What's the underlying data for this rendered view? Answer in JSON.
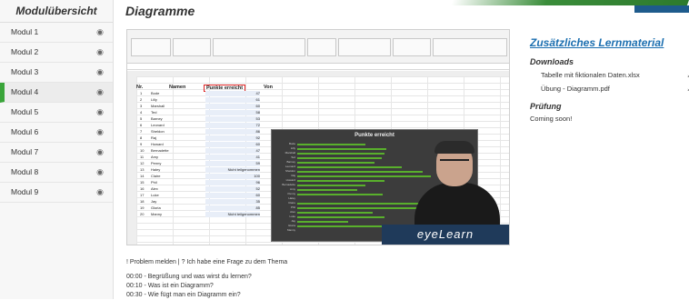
{
  "sidebar": {
    "title": "Modulübersicht",
    "items": [
      {
        "label": "Modul 1"
      },
      {
        "label": "Modul 2"
      },
      {
        "label": "Modul 3"
      },
      {
        "label": "Modul 4",
        "active": true
      },
      {
        "label": "Modul 5"
      },
      {
        "label": "Modul 6"
      },
      {
        "label": "Modul 7"
      },
      {
        "label": "Modul 8"
      },
      {
        "label": "Modul 9"
      }
    ],
    "item_icon": "eye-icon"
  },
  "main": {
    "title": "Diagramme",
    "video": {
      "brand": "eyeLearn",
      "sheet_headers": {
        "nr": "Nr.",
        "name": "Namen",
        "points": "Punkte erreicht",
        "from": "Von"
      },
      "chart_title": "Punkte erreicht",
      "names": [
        "Bode",
        "Lilly",
        "Marshall",
        "Ted",
        "Barney",
        "Leonard",
        "Sheldon",
        "Raj",
        "Howard",
        "Bernadette",
        "Amy",
        "Penny",
        "Haley",
        "Claire",
        "Phil",
        "Alex",
        "Luke",
        "Jay",
        "Gloria",
        "Manny"
      ],
      "points": [
        "47",
        "61",
        "60",
        "58",
        "53",
        "72",
        "86",
        "92",
        "60",
        "47",
        "41",
        "59",
        "Nicht teilgenommen",
        "100",
        "96",
        "52",
        "60",
        "35",
        "85",
        "Nicht teilgenommen"
      ]
    },
    "report_link": "! Problem melden | ? Ich habe eine Frage zu dem Thema",
    "timeline": [
      "00:00 - Begrüßung und was wirst du lernen?",
      "00:10 - Was ist ein Diagramm?",
      "00:30 - Wie fügt man ein Diagramm ein?"
    ]
  },
  "extra": {
    "heading": "Zusätzliches Lernmaterial",
    "downloads_label": "Downloads",
    "downloads": [
      {
        "label": "Tabelle mit fiktionalen Daten.xlsx",
        "icon": "download-icon"
      },
      {
        "label": "Übung - Diagramm.pdf",
        "icon": "download-icon"
      }
    ],
    "exam_label": "Prüfung",
    "exam_text": "Coming soon!"
  },
  "colors": {
    "accent": "#3aa53a",
    "link": "#1c6fb0",
    "brand_bg": "#1f3a5a",
    "bars": "#59b02c"
  }
}
